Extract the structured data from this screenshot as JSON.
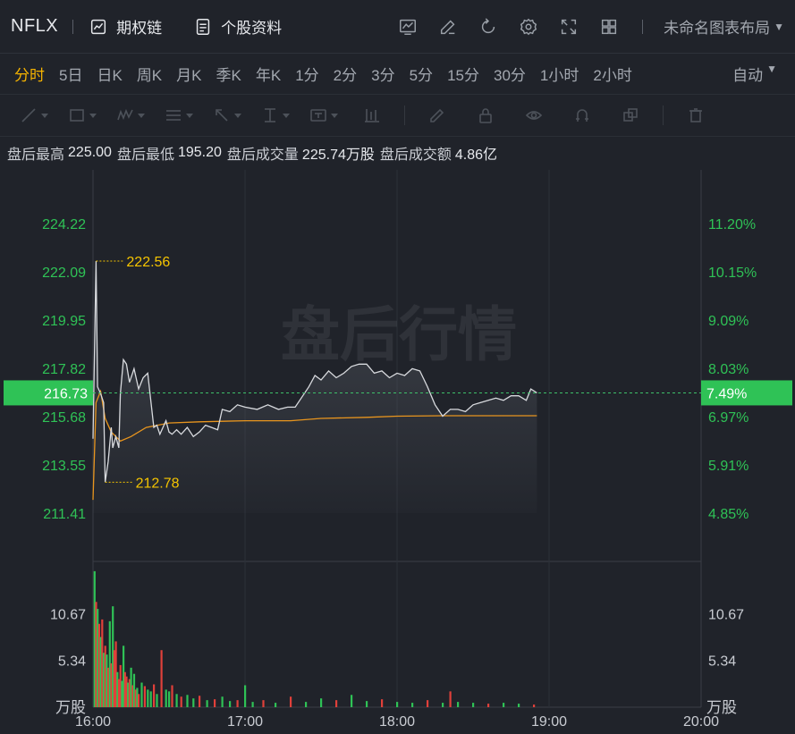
{
  "header": {
    "ticker": "NFLX",
    "options_chain": "期权链",
    "profile": "个股资料",
    "layout": "未命名图表布局",
    "tool_icons": [
      "indicator-icon",
      "edit-icon",
      "refresh-icon",
      "settings-icon",
      "fullscreen-icon",
      "grid-layout-icon"
    ]
  },
  "periods": [
    "分时",
    "5日",
    "日K",
    "周K",
    "月K",
    "季K",
    "年K",
    "1分",
    "2分",
    "3分",
    "5分",
    "15分",
    "30分",
    "1小时",
    "2小时"
  ],
  "active_period": "分时",
  "auto_label": "自动",
  "draw_tools": [
    "line-tool-icon",
    "rect-tool-icon",
    "wave-tool-icon",
    "fib-tool-icon",
    "arrow-tool-icon",
    "measure-tool-icon",
    "text-tool-icon",
    "bar-tool-icon",
    "pen-tool-icon",
    "lock-icon",
    "eye-icon",
    "magnet-icon",
    "clone-icon",
    "trash-icon"
  ],
  "stats": {
    "high_label": "盘后最高",
    "high": "225.00",
    "low_label": "盘后最低",
    "low": "195.20",
    "vol_label": "盘后成交量",
    "vol": "225.74万股",
    "amt_label": "盘后成交额",
    "amt": "4.86亿"
  },
  "watermark": "盘后行情",
  "colors": {
    "up": "#2fc256",
    "down": "#e0403a",
    "avg": "#e8951e",
    "price": "#d8dade",
    "annot": "#f5c400"
  },
  "chart_data": {
    "type": "line",
    "price_ticks": [
      "224.22",
      "222.09",
      "219.95",
      "217.82",
      "215.68",
      "213.55",
      "211.41"
    ],
    "pct_ticks": [
      "11.20%",
      "10.15%",
      "9.09%",
      "8.03%",
      "6.97%",
      "5.91%",
      "4.85%"
    ],
    "current_price": "216.73",
    "current_pct": "7.49%",
    "high_marker": "222.56",
    "low_marker": "212.78",
    "ylim": [
      211.41,
      224.22
    ],
    "x_labels": [
      "16:00",
      "17:00",
      "18:00",
      "19:00",
      "20:00"
    ],
    "x_range_hours": [
      16,
      20
    ],
    "price_series": {
      "x": [
        16.0,
        16.02,
        16.03,
        16.05,
        16.07,
        16.08,
        16.1,
        16.12,
        16.13,
        16.15,
        16.17,
        16.18,
        16.2,
        16.22,
        16.24,
        16.27,
        16.3,
        16.33,
        16.36,
        16.4,
        16.42,
        16.44,
        16.46,
        16.48,
        16.5,
        16.52,
        16.55,
        16.58,
        16.62,
        16.66,
        16.7,
        16.74,
        16.78,
        16.82,
        16.85,
        16.9,
        16.95,
        17.0,
        17.08,
        17.15,
        17.22,
        17.28,
        17.33,
        17.38,
        17.42,
        17.46,
        17.5,
        17.55,
        17.6,
        17.65,
        17.7,
        17.75,
        17.8,
        17.85,
        17.9,
        17.95,
        18.0,
        18.05,
        18.1,
        18.15,
        18.2,
        18.25,
        18.3,
        18.35,
        18.4,
        18.45,
        18.5,
        18.55,
        18.6,
        18.65,
        18.7,
        18.75,
        18.8,
        18.85,
        18.88,
        18.92
      ],
      "y": [
        214.7,
        222.56,
        217.0,
        216.7,
        216.3,
        212.78,
        213.7,
        215.2,
        214.3,
        214.8,
        214.3,
        216.7,
        218.2,
        218.0,
        217.2,
        217.8,
        216.9,
        217.4,
        217.6,
        215.2,
        215.3,
        214.9,
        215.2,
        215.5,
        215.0,
        214.9,
        215.1,
        214.9,
        215.2,
        214.8,
        215.0,
        215.3,
        215.2,
        215.1,
        216.0,
        215.9,
        216.2,
        216.1,
        216.0,
        216.2,
        216.0,
        216.1,
        216.1,
        216.6,
        217.0,
        217.5,
        217.3,
        217.7,
        217.4,
        217.6,
        217.9,
        218.0,
        218.0,
        217.6,
        217.7,
        217.4,
        217.6,
        217.5,
        217.8,
        217.7,
        217.0,
        216.2,
        215.7,
        216.0,
        216.0,
        215.9,
        216.2,
        216.3,
        216.4,
        216.5,
        216.4,
        216.6,
        216.6,
        216.4,
        216.9,
        216.73
      ]
    },
    "avg_series": {
      "x": [
        16.0,
        16.02,
        16.05,
        16.08,
        16.12,
        16.18,
        16.25,
        16.35,
        16.5,
        16.7,
        17.0,
        17.3,
        17.5,
        17.8,
        18.0,
        18.3,
        18.6,
        18.92
      ],
      "y": [
        212.0,
        216.3,
        216.8,
        215.6,
        215.0,
        214.6,
        214.8,
        215.2,
        215.4,
        215.45,
        215.5,
        215.5,
        215.6,
        215.65,
        215.7,
        215.72,
        215.72,
        215.72
      ]
    },
    "volume": {
      "unit": "万股",
      "ticks": [
        "10.67",
        "5.34"
      ],
      "ylim": [
        0,
        16
      ],
      "x": [
        16.01,
        16.02,
        16.03,
        16.04,
        16.05,
        16.06,
        16.07,
        16.08,
        16.09,
        16.1,
        16.11,
        16.12,
        16.13,
        16.14,
        16.15,
        16.16,
        16.17,
        16.18,
        16.19,
        16.2,
        16.21,
        16.22,
        16.23,
        16.24,
        16.25,
        16.26,
        16.27,
        16.28,
        16.29,
        16.3,
        16.32,
        16.34,
        16.36,
        16.38,
        16.4,
        16.42,
        16.45,
        16.48,
        16.5,
        16.52,
        16.55,
        16.58,
        16.62,
        16.66,
        16.7,
        16.75,
        16.8,
        16.85,
        16.9,
        16.95,
        17.0,
        17.05,
        17.12,
        17.2,
        17.3,
        17.4,
        17.5,
        17.6,
        17.7,
        17.8,
        17.9,
        18.0,
        18.1,
        18.2,
        18.3,
        18.35,
        18.4,
        18.5,
        18.6,
        18.7,
        18.8,
        18.9
      ],
      "v": [
        15.5,
        12.0,
        11.2,
        9.5,
        8.0,
        10.0,
        6.2,
        7.0,
        6.0,
        4.5,
        9.8,
        5.0,
        11.5,
        6.5,
        7.5,
        4.0,
        3.2,
        4.8,
        3.0,
        7.0,
        4.0,
        3.5,
        2.8,
        3.2,
        4.5,
        2.5,
        3.8,
        2.0,
        2.2,
        1.5,
        2.8,
        2.4,
        2.0,
        1.8,
        2.6,
        1.5,
        6.5,
        2.0,
        1.8,
        2.5,
        1.5,
        1.2,
        1.4,
        1.0,
        1.3,
        0.8,
        0.9,
        1.2,
        0.7,
        0.8,
        2.5,
        0.6,
        0.8,
        0.5,
        1.2,
        0.6,
        1.0,
        0.8,
        1.4,
        0.7,
        0.9,
        0.6,
        0.5,
        0.8,
        0.5,
        1.8,
        0.6,
        0.5,
        0.4,
        0.5,
        0.4,
        0.3
      ],
      "up": [
        true,
        false,
        true,
        false,
        true,
        false,
        true,
        false,
        true,
        false,
        true,
        false,
        true,
        false,
        false,
        true,
        false,
        false,
        true,
        true,
        false,
        false,
        true,
        false,
        true,
        false,
        true,
        false,
        true,
        false,
        true,
        false,
        true,
        true,
        false,
        true,
        false,
        true,
        true,
        false,
        true,
        false,
        true,
        true,
        false,
        true,
        false,
        true,
        true,
        false,
        true,
        true,
        false,
        true,
        false,
        true,
        true,
        false,
        true,
        true,
        false,
        true,
        true,
        false,
        true,
        false,
        true,
        true,
        false,
        true,
        true,
        false
      ]
    }
  }
}
